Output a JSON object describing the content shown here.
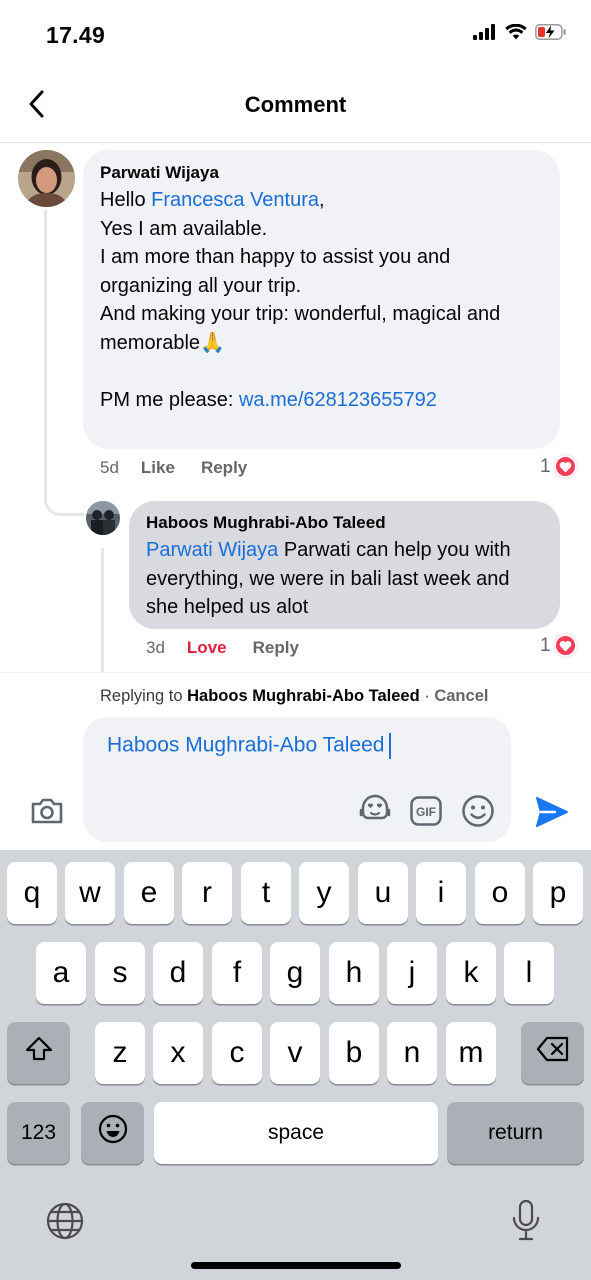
{
  "status": {
    "time": "17.49"
  },
  "header": {
    "title": "Comment"
  },
  "comments": [
    {
      "author": "Parwati Wijaya",
      "greeting": "Hello ",
      "mention": "Francesca Ventura",
      "greeting_suffix": ",",
      "body": "\nYes I am available.\nI am more than happy to assist you and organizing all your trip.\nAnd making your trip: wonderful, magical and memorable🙏\n\n",
      "pm_label": "PM me please: ",
      "link": "wa.me/628123655792",
      "time": "5d",
      "like_label": "Like",
      "reply_label": "Reply",
      "reaction_count": "1"
    },
    {
      "author": "Haboos Mughrabi-Abo Taleed",
      "mention": "Parwati Wijaya",
      "body": " Parwati can help you with everything, we were in bali last week and she helped us alot",
      "time": "3d",
      "like_label": "Love",
      "reply_label": "Reply",
      "reaction_count": "1"
    }
  ],
  "reply_bar": {
    "prefix": "Replying to ",
    "target": "Haboos Mughrabi-Abo Taleed",
    "separator": " · ",
    "cancel": "Cancel",
    "input_value": "Haboos Mughrabi-Abo Taleed"
  },
  "icons": [
    "back-icon",
    "camera-icon",
    "avatar-sticker-icon",
    "gif-icon",
    "emoji-icon",
    "send-icon",
    "heart-icon"
  ],
  "keyboard": {
    "row1": [
      "q",
      "w",
      "e",
      "r",
      "t",
      "y",
      "u",
      "i",
      "o",
      "p"
    ],
    "row2": [
      "a",
      "s",
      "d",
      "f",
      "g",
      "h",
      "j",
      "k",
      "l"
    ],
    "row3": [
      "z",
      "x",
      "c",
      "v",
      "b",
      "n",
      "m"
    ],
    "numbers_label": "123",
    "space_label": "space",
    "return_label": "return"
  },
  "colors": {
    "link": "#1a6ed8",
    "love": "#e41e3f",
    "send": "#1877f2"
  }
}
